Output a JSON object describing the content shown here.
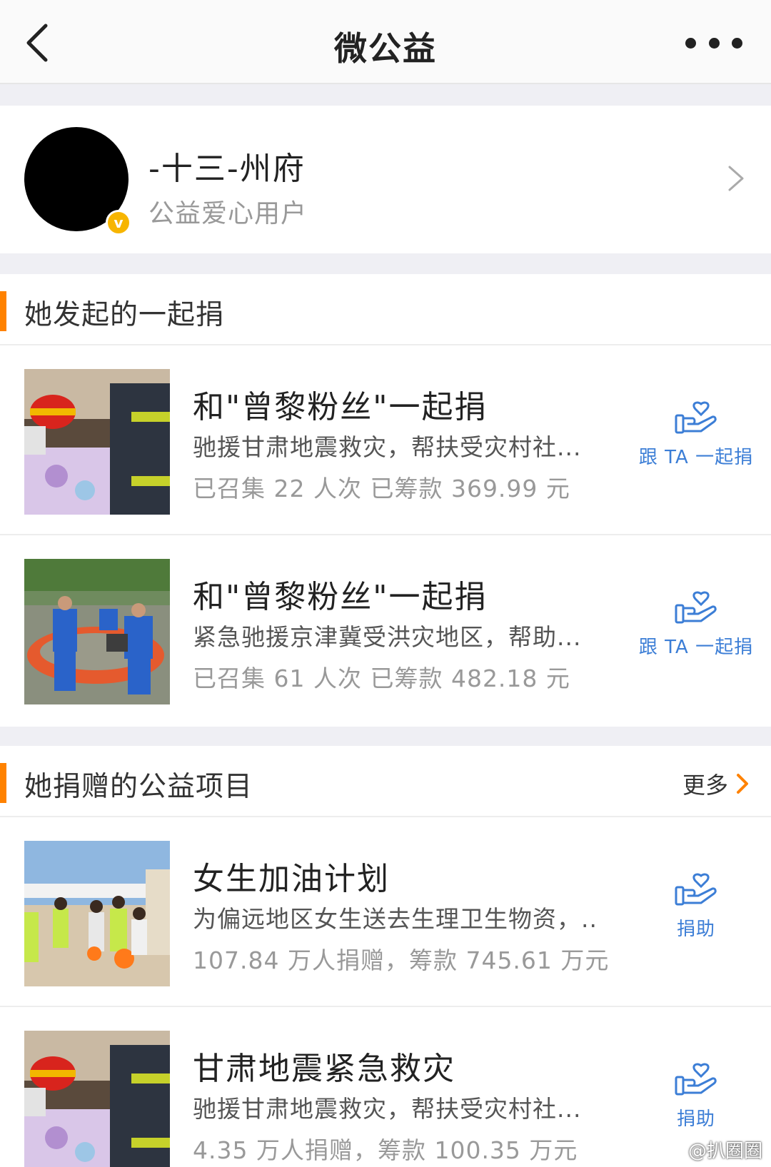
{
  "navbar": {
    "title": "微公益"
  },
  "profile": {
    "name": "-十三-州府",
    "subtitle": "公益爱心用户",
    "badge": "v"
  },
  "section1": {
    "title": "她发起的一起捐",
    "items": [
      {
        "title": "和\"曾黎粉丝\"一起捐",
        "desc": "驰援甘肃地震救灾，帮扶受灾村社...",
        "stats": "已召集 22 人次 已筹款 369.99 元",
        "action": "跟 TA 一起捐"
      },
      {
        "title": "和\"曾黎粉丝\"一起捐",
        "desc": "紧急驰援京津冀受洪灾地区，帮助...",
        "stats": "已召集 61 人次 已筹款 482.18 元",
        "action": "跟 TA 一起捐"
      }
    ]
  },
  "section2": {
    "title": "她捐赠的公益项目",
    "more": "更多",
    "items": [
      {
        "title": "女生加油计划",
        "desc": "为偏远地区女生送去生理卫生物资，..",
        "stats": "107.84 万人捐赠，筹款 745.61 万元",
        "action": "捐助"
      },
      {
        "title": "甘肃地震紧急救灾",
        "desc": "驰援甘肃地震救灾，帮扶受灾村社...",
        "stats": "4.35 万人捐赠，筹款 100.35 万元",
        "action": "捐助"
      }
    ]
  },
  "watermark": "@扒圈圈",
  "colors": {
    "accent": "#ff8200",
    "link": "#3c7ed6",
    "badge": "#f7b500"
  }
}
